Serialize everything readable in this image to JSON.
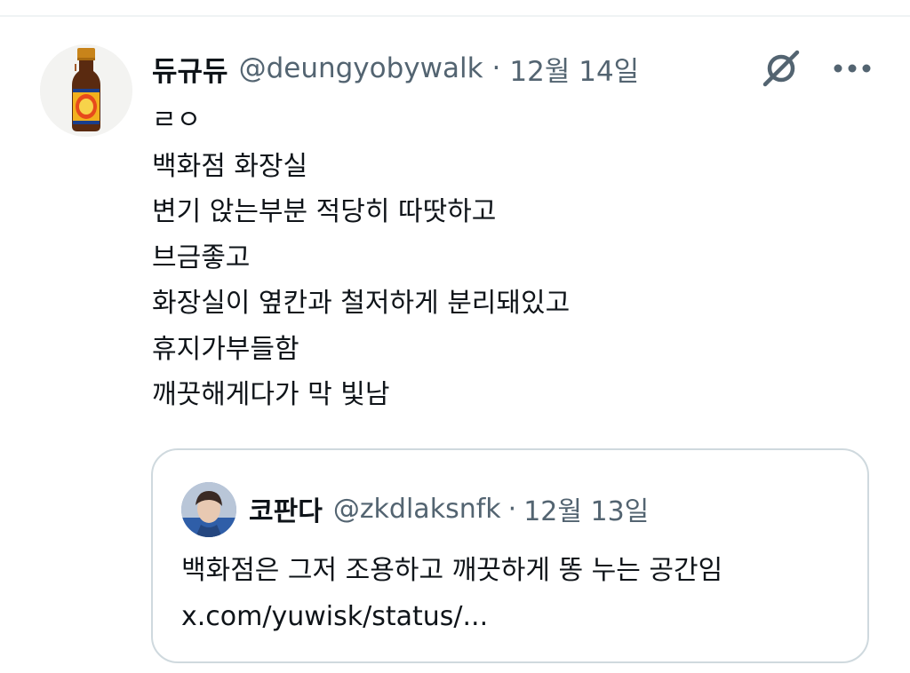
{
  "tweet": {
    "author": {
      "display_name": "듀규듀",
      "handle": "@deungyobywalk",
      "avatar_icon": "vitamin-drink-bottle-avatar"
    },
    "separator": "·",
    "date": "12월 14일",
    "body": "ㄹㅇ\n백화점 화장실\n변기 앉는부분 적당히 따땃하고\n브금좋고\n화장실이 옆칸과 철저하게 분리돼있고\n휴지가부들함\n깨끗해게다가 막 빛남",
    "icons": {
      "grok": "grok-icon",
      "more": "more-options-icon"
    }
  },
  "quoted_tweet": {
    "author": {
      "display_name": "코판다",
      "handle": "@zkdlaksnfk",
      "avatar_icon": "profile-photo-avatar"
    },
    "separator": "·",
    "date": "12월 13일",
    "text": "백화점은 그저 조용하고 깨끗하게 똥 누는 공간임",
    "link": "x.com/yuwisk/status/..."
  },
  "colors": {
    "text_primary": "#0f1419",
    "text_secondary": "#536471",
    "border": "#cfd9de",
    "divider": "#eff3f4"
  }
}
